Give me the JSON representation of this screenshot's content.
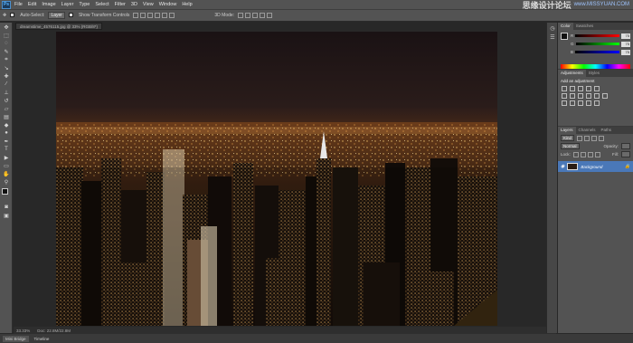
{
  "app": {
    "logo": "Ps"
  },
  "menu": [
    "File",
    "Edit",
    "Image",
    "Layer",
    "Type",
    "Select",
    "Filter",
    "3D",
    "View",
    "Window",
    "Help"
  ],
  "watermark": {
    "cn": "思缘设计论坛",
    "url": "www.MISSYUAN.COM"
  },
  "options": {
    "auto_select_label": "Auto-Select:",
    "auto_select_value": "Layer",
    "show_transform_label": "Show Transform Controls",
    "mode_label": "3D Mode:"
  },
  "document": {
    "tab_title": "dreamstime_4576115.jpg @ 33% (RGB/8*)",
    "zoom": "33.33%",
    "doc_info": "Doc: 22.8M/22.8M"
  },
  "bottom_tabs": [
    "Mini Bridge",
    "Timeline"
  ],
  "panels": {
    "color_tabs": [
      "Color",
      "Swatches"
    ],
    "channels": [
      {
        "label": "R",
        "value": "75"
      },
      {
        "label": "G",
        "value": "75"
      },
      {
        "label": "B",
        "value": "75"
      }
    ],
    "adj_tabs": [
      "Adjustments",
      "Styles"
    ],
    "adj_title": "Add an adjustment",
    "layers_tabs": [
      "Layers",
      "Channels",
      "Paths"
    ],
    "kind_label": "Kind",
    "blend_mode": "Normal",
    "opacity_label": "Opacity:",
    "lock_label": "Lock:",
    "fill_label": "Fill:",
    "layer_name": "Background"
  }
}
